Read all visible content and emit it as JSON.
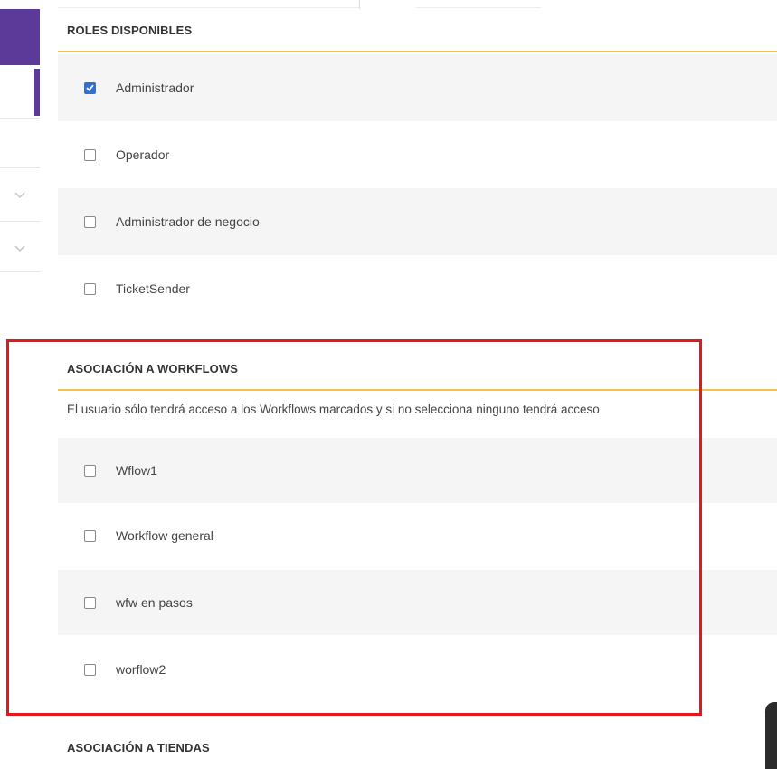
{
  "roles": {
    "title": "ROLES DISPONIBLES",
    "items": [
      {
        "label": "Administrador",
        "checked": true
      },
      {
        "label": "Operador",
        "checked": false
      },
      {
        "label": "Administrador de negocio",
        "checked": false
      },
      {
        "label": "TicketSender",
        "checked": false
      }
    ]
  },
  "workflows": {
    "title": "ASOCIACIÓN A WORKFLOWS",
    "description": "El usuario sólo tendrá acceso a los Workflows marcados y si no selecciona ninguno tendrá acceso",
    "items": [
      {
        "label": "Wflow1",
        "checked": false
      },
      {
        "label": "Workflow general",
        "checked": false
      },
      {
        "label": "wfw en pasos",
        "checked": false
      },
      {
        "label": "worflow2",
        "checked": false
      }
    ]
  },
  "stores": {
    "title": "ASOCIACIÓN A TIENDAS"
  },
  "colors": {
    "accent_purple": "#5b3a9a",
    "header_underline": "#f2c24f",
    "checkbox_checked": "#2f6fd6",
    "highlight_red": "#e8161b"
  },
  "icons": {
    "sidebar_expand": "chevron-down-icon",
    "checked_mark": "checkmark-icon"
  }
}
